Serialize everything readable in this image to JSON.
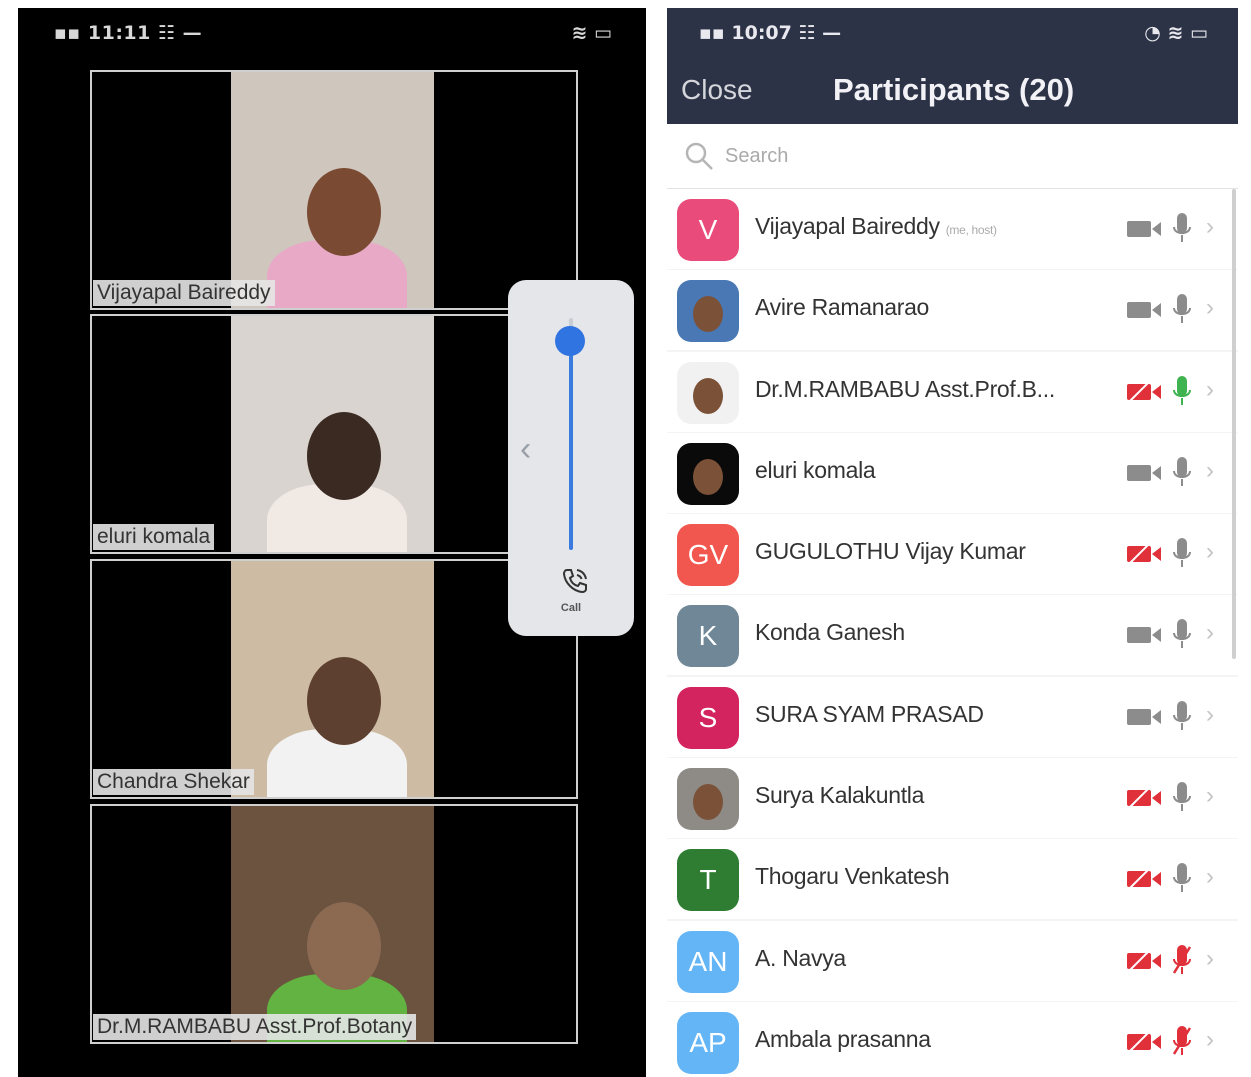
{
  "left_phone": {
    "status_time": "11:11",
    "tiles": [
      {
        "name": "Vijayapal Baireddy",
        "bg": "#cfc6be",
        "head": "#7a4a32",
        "shirt": "#e8a9c7"
      },
      {
        "name": "eluri komala",
        "bg": "#d9d4d0",
        "head": "#3a2a22",
        "shirt": "#f1e9e4"
      },
      {
        "name": "Chandra Shekar",
        "bg": "#cdbba3",
        "head": "#5e4030",
        "shirt": "#f2f2f2"
      },
      {
        "name": "Dr.M.RAMBABU Asst.Prof.Botany",
        "bg": "#6b5340",
        "head": "#8c6a52",
        "shirt": "#62b341"
      }
    ],
    "volume_level_fraction": 0.9,
    "call_label": "Call"
  },
  "right_phone": {
    "status_time": "10:07",
    "close_label": "Close",
    "title": "Participants (20)",
    "search_placeholder": "Search",
    "participants": [
      {
        "initials": "V",
        "name": "Vijayapal Baireddy",
        "host_tag": "(me, host)",
        "avatar_color": "#e94b7b",
        "photo": false,
        "video_muted": false,
        "mic_state": "muted"
      },
      {
        "initials": "",
        "name": "Avire Ramanarao",
        "host_tag": "",
        "avatar_color": "#4a78b4",
        "photo": true,
        "video_muted": false,
        "mic_state": "muted"
      },
      {
        "initials": "",
        "name": "Dr.M.RAMBABU Asst.Prof.B...",
        "host_tag": "",
        "avatar_color": "#f1f1f1",
        "photo": true,
        "video_muted": true,
        "mic_state": "speaking"
      },
      {
        "initials": "",
        "name": "eluri komala",
        "host_tag": "",
        "avatar_color": "#0a0a0a",
        "photo": true,
        "video_muted": false,
        "mic_state": "muted"
      },
      {
        "initials": "GV",
        "name": "GUGULOTHU Vijay Kumar",
        "host_tag": "",
        "avatar_color": "#f2574f",
        "photo": false,
        "video_muted": true,
        "mic_state": "muted"
      },
      {
        "initials": "K",
        "name": "Konda Ganesh",
        "host_tag": "",
        "avatar_color": "#6f8797",
        "photo": false,
        "video_muted": false,
        "mic_state": "muted"
      },
      {
        "initials": "S",
        "name": "SURA SYAM PRASAD",
        "host_tag": "",
        "avatar_color": "#d3245f",
        "photo": false,
        "video_muted": false,
        "mic_state": "muted"
      },
      {
        "initials": "",
        "name": "Surya Kalakuntla",
        "host_tag": "",
        "avatar_color": "#8e8a86",
        "photo": true,
        "video_muted": true,
        "mic_state": "muted"
      },
      {
        "initials": "T",
        "name": "Thogaru Venkatesh",
        "host_tag": "",
        "avatar_color": "#2e7d32",
        "photo": false,
        "video_muted": true,
        "mic_state": "muted"
      },
      {
        "initials": "AN",
        "name": "A. Navya",
        "host_tag": "",
        "avatar_color": "#64b5f6",
        "photo": false,
        "video_muted": true,
        "mic_state": "off"
      },
      {
        "initials": "AP",
        "name": "Ambala prasanna",
        "host_tag": "",
        "avatar_color": "#64b5f6",
        "photo": false,
        "video_muted": true,
        "mic_state": "off"
      }
    ]
  },
  "colors": {
    "header_bg": "#2d3347",
    "video_off_red": "#e0303a",
    "mic_gray": "#8c8c8c",
    "mic_green": "#3fb34f",
    "volume_blue": "#2f74e0"
  }
}
